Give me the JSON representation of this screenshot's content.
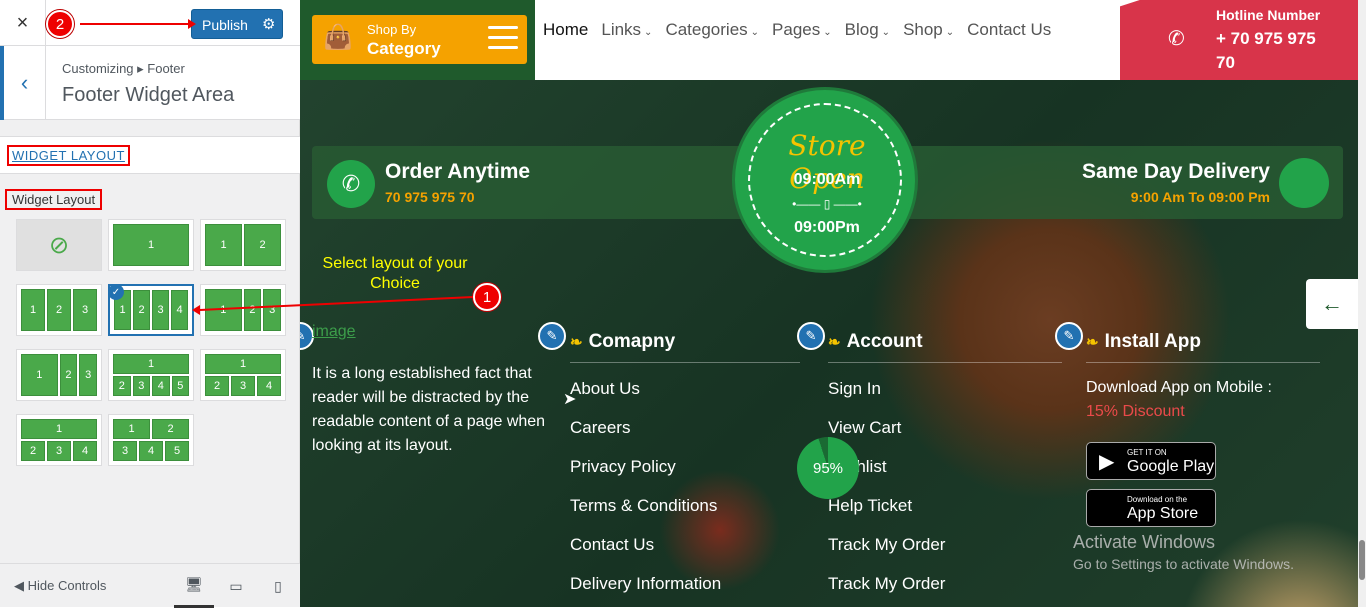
{
  "sidebar": {
    "close_icon": "×",
    "publish_label": "Publish",
    "gear_icon": "⚙",
    "marker_publish": "2",
    "breadcrumb": "Customizing ▸ Footer",
    "section_title": "Footer Widget Area",
    "widget_layout_link": "WIDGET LAYOUT",
    "widget_layout_label": "Widget Layout",
    "layouts": [
      {
        "rows": [
          [
            "⊘"
          ]
        ],
        "type": "none"
      },
      {
        "rows": [
          [
            "1"
          ]
        ]
      },
      {
        "rows": [
          [
            "1",
            "2"
          ]
        ]
      },
      {
        "rows": [
          [
            "1",
            "2",
            "3"
          ]
        ]
      },
      {
        "rows": [
          [
            "1",
            "2",
            "3",
            "4"
          ]
        ],
        "selected": true
      },
      {
        "rows": [
          [
            "1",
            "2",
            "3"
          ]
        ],
        "alt": true
      },
      {
        "rows": [
          [
            "1",
            "2",
            "3"
          ]
        ],
        "alt": true
      },
      {
        "rows": [
          [
            "1"
          ],
          [
            "2",
            "3",
            "4",
            "5"
          ]
        ]
      },
      {
        "rows": [
          [
            "1"
          ],
          [
            "2",
            "3",
            "4"
          ]
        ]
      },
      {
        "rows": [
          [
            "1"
          ],
          [
            "2",
            "3",
            "4"
          ]
        ]
      },
      {
        "rows": [
          [
            "1",
            "2"
          ],
          [
            "3",
            "4",
            "5"
          ]
        ]
      }
    ],
    "hide_controls": "Hide Controls",
    "devices": [
      "desktop-icon",
      "tablet-icon",
      "mobile-icon"
    ]
  },
  "header": {
    "category": {
      "line1": "Shop By",
      "line2": "Category"
    },
    "nav": [
      {
        "label": "Home",
        "caret": false
      },
      {
        "label": "Links",
        "caret": true
      },
      {
        "label": "Categories",
        "caret": true
      },
      {
        "label": "Pages",
        "caret": true
      },
      {
        "label": "Blog",
        "caret": true
      },
      {
        "label": "Shop",
        "caret": true
      },
      {
        "label": "Contact Us",
        "caret": false
      }
    ],
    "hotline_title": "Hotline Number",
    "hotline_number": "+ 70 975 975 70"
  },
  "band": {
    "order_title": "Order Anytime",
    "order_phone": "70 975 975 70",
    "delivery_title": "Same Day Delivery",
    "delivery_time": "9:00 Am To 09:00 Pm"
  },
  "seal": {
    "title": "Store Open",
    "open_time": "09:00Am",
    "separator": "•——  ▯  ——•",
    "close_time": "09:00Pm"
  },
  "callout": {
    "text": "Select layout of your Choice",
    "marker": "1"
  },
  "footer": {
    "image_alt": "image",
    "about": "It is a long established fact that reader will be distracted by the readable content of a page when looking at its layout.",
    "company": {
      "title": "Comapny",
      "links": [
        "About Us",
        "Careers",
        "Privacy Policy",
        "Terms & Conditions",
        "Contact Us",
        "Delivery Information"
      ]
    },
    "account": {
      "title": "Account",
      "links": [
        "Sign In",
        "View Cart",
        "Wishlist",
        "Help Ticket",
        "Track My Order",
        "Track My Order"
      ]
    },
    "app": {
      "title": "Install App",
      "text": "Download App on Mobile :",
      "discount": "15% Discount",
      "google": {
        "small": "GET IT ON",
        "big": "Google Play"
      },
      "apple": {
        "small": "Download on the",
        "big": "App Store"
      }
    }
  },
  "progress": {
    "value": "95%",
    "fraction": 0.95
  },
  "activate": {
    "line1": "Activate Windows",
    "line2": "Go to Settings to activate Windows."
  },
  "side_arrow": "←",
  "colors": {
    "green": "#22a34a",
    "orange": "#f5a200",
    "red": "#d8344a",
    "blue": "#2271b1"
  }
}
